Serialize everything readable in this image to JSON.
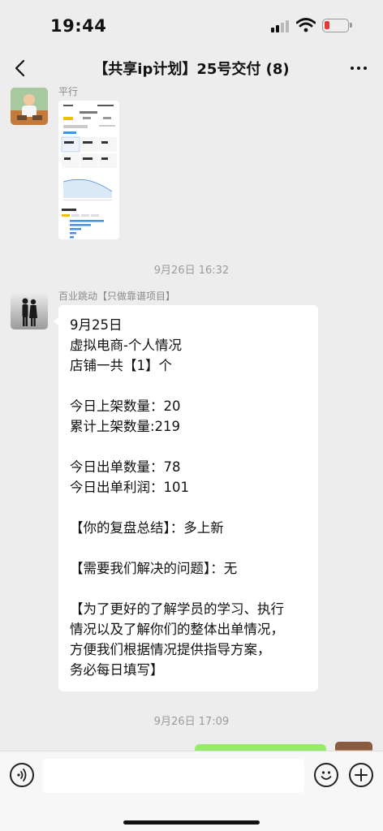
{
  "status_bar": {
    "time": "19:44"
  },
  "nav": {
    "title": "【共享ip计划】25号交付 (8)"
  },
  "messages": {
    "first": {
      "sender_name": "平行"
    },
    "timestamp_1": "9月26日 16:32",
    "second": {
      "sender_name": "百业跳动【只做靠谱项目】",
      "lines": [
        "9月25日",
        "虚拟电商-个人情况",
        "店铺一共【1】个",
        "",
        "今日上架数量：20",
        "累计上架数量:219",
        "",
        "今日出单数量：78",
        "今日出单利润：101",
        "",
        "【你的复盘总结】：多上新",
        "",
        "【需要我们解决的问题】：无",
        "",
        "【为了更好的了解学员的学习、执行",
        "情况以及了解你们的整体出单情况，",
        "方便我们根据情况提供指导方案，",
        "务必每日填写】"
      ]
    },
    "timestamp_2": "9月26日 17:09"
  },
  "input": {
    "value": ""
  },
  "colors": {
    "chat_bg": "#ededed",
    "sent_bubble": "#95ec69",
    "received_bubble": "#ffffff"
  },
  "icons": [
    "back-arrow",
    "more-dots",
    "voice",
    "emoji",
    "plus"
  ]
}
